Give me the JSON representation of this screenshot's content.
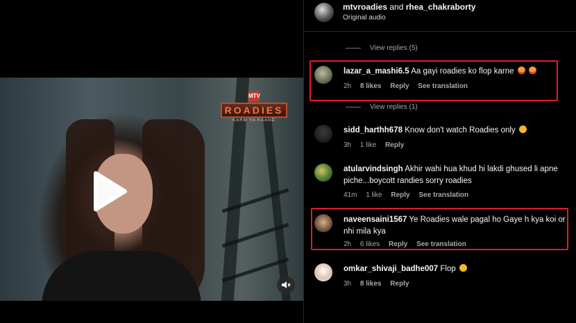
{
  "post": {
    "user1": "mtvroadies",
    "joiner": "and",
    "user2": "rhea_chakraborty",
    "audio": "Original audio"
  },
  "video": {
    "logo_network": "MTV",
    "logo_title": "ROADIES",
    "logo_tagline": "KARM YA KAAND"
  },
  "replies": [
    {
      "label": "View replies (5)"
    },
    {
      "label": "View replies (1)"
    }
  ],
  "comments": [
    {
      "username": "lazar_a_mashi6.5",
      "text": "Aa gayi roadies ko flop karne",
      "emojis": [
        "heart-eyes",
        "heart-eyes"
      ],
      "time": "2h",
      "likes": "8 likes",
      "reply": "Reply",
      "translate": "See translation"
    },
    {
      "username": "sidd_harthh678",
      "text": "Know don't watch Roadies only",
      "emojis": [
        "laughing"
      ],
      "time": "3h",
      "likes": "1 like",
      "reply": "Reply",
      "translate": ""
    },
    {
      "username": "atularvindsingh",
      "text": "Akhir wahi hua khud hi lakdi ghused li apne piche...boycott randies sorry roadies",
      "emojis": [],
      "time": "41m",
      "likes": "1 like",
      "reply": "Reply",
      "translate": "See translation"
    },
    {
      "username": "naveensaini1567",
      "text": "Ye Roadies wale pagal ho Gaye h kya koi or nhi mila kya",
      "emojis": [],
      "time": "2h",
      "likes": "6 likes",
      "reply": "Reply",
      "translate": "See translation"
    },
    {
      "username": "omkar_shivaji_badhe007",
      "text": "Flop",
      "emojis": [
        "sad"
      ],
      "time": "3h",
      "likes": "8 likes",
      "reply": "Reply",
      "translate": ""
    }
  ],
  "colors": {
    "highlight": "#e21c24",
    "background": "#000000",
    "muted": "#a8a8a8"
  }
}
